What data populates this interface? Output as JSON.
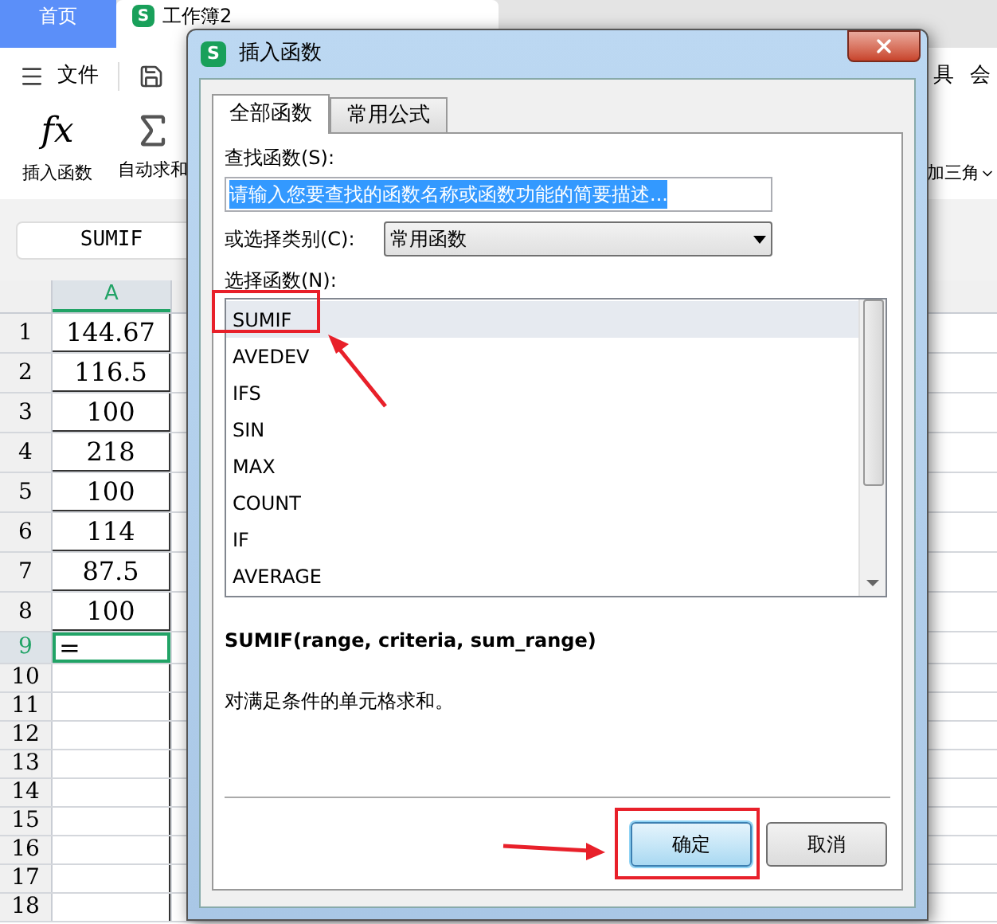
{
  "app_tabs": [
    {
      "label": "首页",
      "selected": false
    },
    {
      "label": "工作簿2",
      "selected": true,
      "logo": "S"
    }
  ],
  "menu": {
    "file": "文件",
    "right_items": [
      "具",
      "会"
    ]
  },
  "ribbon": {
    "buttons": [
      {
        "label": "插入函数",
        "icon_text": "fx"
      },
      {
        "label": "自动求和"
      }
    ],
    "right_label": "加三角"
  },
  "name_box": "SUMIF",
  "sheet": {
    "column": "A",
    "rows": [
      {
        "label": "1",
        "value": "144.67",
        "selected": false
      },
      {
        "label": "2",
        "value": "116.5",
        "selected": false
      },
      {
        "label": "3",
        "value": "100",
        "selected": false
      },
      {
        "label": "4",
        "value": "218",
        "selected": false
      },
      {
        "label": "5",
        "value": "100",
        "selected": false
      },
      {
        "label": "6",
        "value": "114",
        "selected": false
      },
      {
        "label": "7",
        "value": "87.5",
        "selected": false
      },
      {
        "label": "8",
        "value": "100",
        "selected": false
      },
      {
        "label": "9",
        "value": "=",
        "selected": true
      },
      {
        "label": "10",
        "selected": false
      },
      {
        "label": "11",
        "selected": false
      },
      {
        "label": "12",
        "selected": false
      },
      {
        "label": "13",
        "selected": false
      },
      {
        "label": "14",
        "selected": false
      },
      {
        "label": "15",
        "selected": false
      },
      {
        "label": "16",
        "selected": false
      },
      {
        "label": "17",
        "selected": false
      },
      {
        "label": "18",
        "selected": false
      }
    ]
  },
  "dialog": {
    "logo": "S",
    "title": "插入函数",
    "tabs": [
      {
        "label": "全部函数",
        "selected": true
      },
      {
        "label": "常用公式",
        "selected": false
      }
    ],
    "search_label": "查找函数(S):",
    "search_value": "请输入您要查找的函数名称或函数功能的简要描述...",
    "category_label": "或选择类别(C):",
    "category_value": "常用函数",
    "list_label": "选择函数(N):",
    "functions": [
      {
        "name": "SUMIF",
        "selected": true
      },
      {
        "name": "AVEDEV",
        "selected": false
      },
      {
        "name": "IFS",
        "selected": false
      },
      {
        "name": "SIN",
        "selected": false
      },
      {
        "name": "MAX",
        "selected": false
      },
      {
        "name": "COUNT",
        "selected": false
      },
      {
        "name": "IF",
        "selected": false
      },
      {
        "name": "AVERAGE",
        "selected": false
      }
    ],
    "signature": "SUMIF(range, criteria, sum_range)",
    "description": "对满足条件的单元格求和。",
    "buttons": [
      {
        "label": "确定",
        "kind": "primary"
      },
      {
        "label": "取消",
        "kind": "normal"
      }
    ]
  }
}
